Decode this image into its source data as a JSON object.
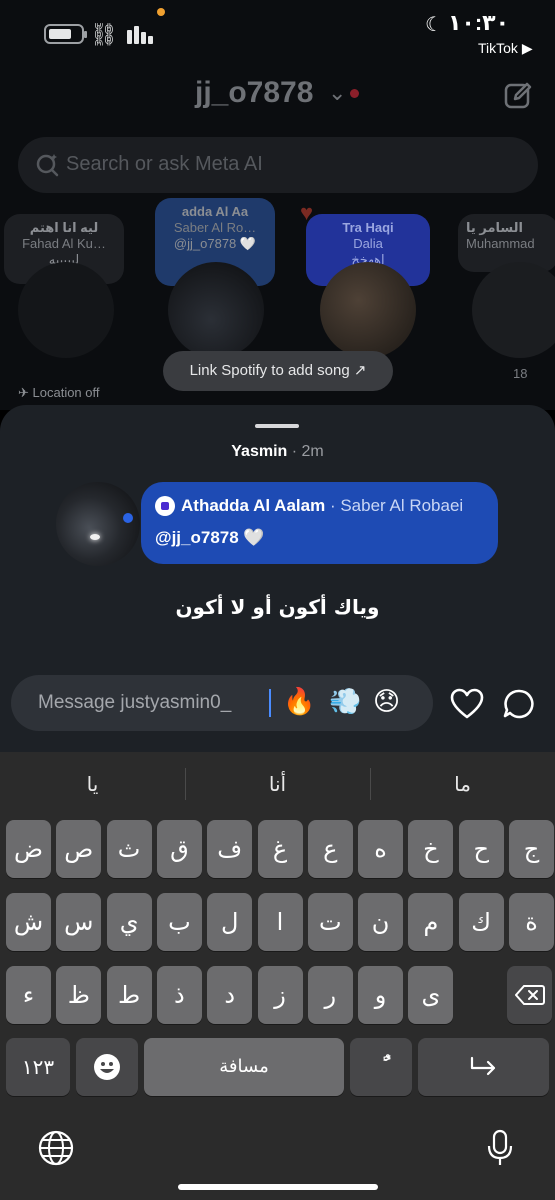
{
  "status_bar": {
    "time": "١٠:٣٠",
    "back_app": "TikTok ▶"
  },
  "header": {
    "username": "jj_o7878"
  },
  "search": {
    "placeholder": "Search or ask Meta AI"
  },
  "notes": [
    {
      "title": "ليه انا اهتم",
      "subtitle": "Fahad Al Ku…",
      "extra": "ليييييه"
    },
    {
      "title": "adda Al Aa",
      "subtitle": "Saber Al Ro…",
      "extra": "@jj_o7878 🤍"
    },
    {
      "title": "Tra Haqi",
      "subtitle": "Dalia",
      "extra": "اههخخ"
    },
    {
      "title": "السامر يا",
      "subtitle": "Muhammad",
      "extra": ""
    }
  ],
  "location_label": "Location off",
  "count_label": "18",
  "spotify_pill": "Link Spotify to add song ↗",
  "sheet": {
    "sender": "Yasmin",
    "time": "· 2m",
    "song_title": "Athadda Al Aalam",
    "song_artist": "· Saber Al Robaei",
    "mention": "@jj_o7878",
    "heart": "🤍",
    "lyric": "وياك أكون أو لا أكون"
  },
  "message": {
    "placeholder": "Message justyasmin0_",
    "emojis": [
      "🔥",
      "💨",
      "😞"
    ]
  },
  "keyboard": {
    "suggestions": [
      "يا",
      "أنا",
      "ما"
    ],
    "row1": [
      "ض",
      "ص",
      "ث",
      "ق",
      "ف",
      "غ",
      "ع",
      "ه",
      "خ",
      "ح",
      "ج"
    ],
    "row2": [
      "ش",
      "س",
      "ي",
      "ب",
      "ل",
      "ا",
      "ت",
      "ن",
      "م",
      "ك",
      "ة"
    ],
    "row3": [
      "ء",
      "ظ",
      "ط",
      "ذ",
      "د",
      "ز",
      "ر",
      "و",
      "ى"
    ],
    "numbers_key": "١٢٣",
    "space_key": "مسافة",
    "diacritic_key": "ًٌ"
  }
}
